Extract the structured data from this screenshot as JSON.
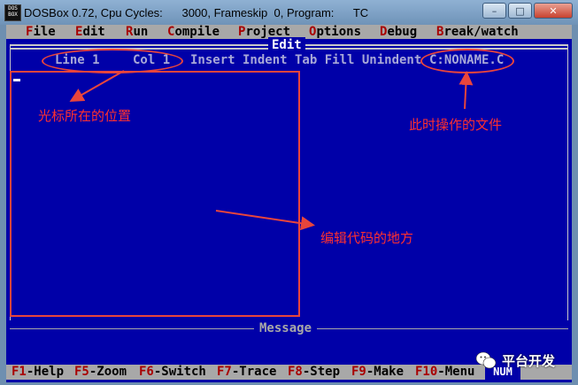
{
  "window": {
    "title": "DOSBox 0.72, Cpu Cycles:      3000, Frameskip  0, Program:      TC",
    "icon_text": "DOS BOX",
    "buttons": {
      "minimize": "–",
      "maximize": "□",
      "close": "✕"
    }
  },
  "menu": [
    {
      "hot": "F",
      "rest": "ile"
    },
    {
      "hot": "E",
      "rest": "dit"
    },
    {
      "hot": "R",
      "rest": "un"
    },
    {
      "hot": "C",
      "rest": "ompile"
    },
    {
      "hot": "P",
      "rest": "roject"
    },
    {
      "hot": "O",
      "rest": "ptions"
    },
    {
      "hot": "D",
      "rest": "ebug"
    },
    {
      "hot": "B",
      "rest": "reak/watch"
    }
  ],
  "editor": {
    "title": "Edit",
    "status": {
      "line": "Line 1",
      "col": "Col 1",
      "modes": "Insert Indent Tab Fill Unindent",
      "filename": "C:NONAME.C"
    },
    "message_title": "Message"
  },
  "fkeys": [
    {
      "key": "F1",
      "label": "-Help"
    },
    {
      "key": "F5",
      "label": "-Zoom"
    },
    {
      "key": "F6",
      "label": "-Switch"
    },
    {
      "key": "F7",
      "label": "-Trace"
    },
    {
      "key": "F8",
      "label": "-Step"
    },
    {
      "key": "F9",
      "label": "-Make"
    },
    {
      "key": "F10",
      "label": "-Menu"
    }
  ],
  "num_indicator": "NUM",
  "annotations": {
    "cursor_position": "光标所在的位置",
    "current_file": "此时操作的文件",
    "code_area": "编辑代码的地方",
    "color": "#e8453c"
  },
  "watermark": "平台开发"
}
